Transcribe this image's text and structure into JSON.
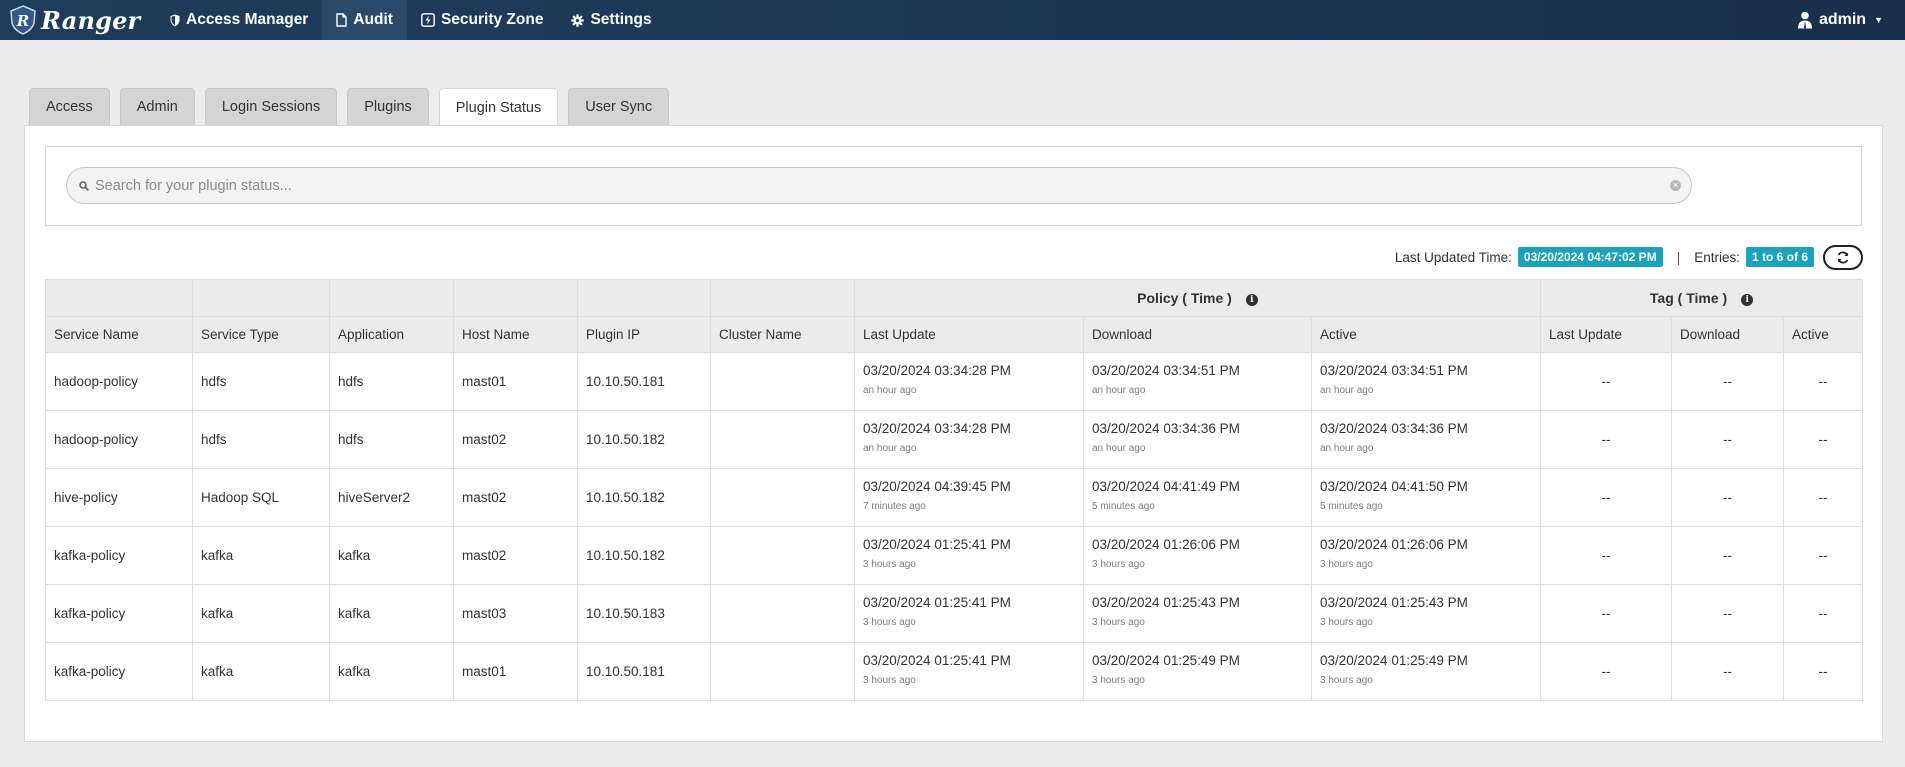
{
  "navbar": {
    "brand": "Ranger",
    "items": [
      {
        "label": "Access Manager",
        "icon": "shield-icon"
      },
      {
        "label": "Audit",
        "icon": "file-icon"
      },
      {
        "label": "Security Zone",
        "icon": "bolt-box-icon"
      },
      {
        "label": "Settings",
        "icon": "gear-icon"
      }
    ],
    "active_item": "Audit",
    "user": "admin"
  },
  "tabs": [
    {
      "label": "Access"
    },
    {
      "label": "Admin"
    },
    {
      "label": "Login Sessions"
    },
    {
      "label": "Plugins"
    },
    {
      "label": "Plugin Status"
    },
    {
      "label": "User Sync"
    }
  ],
  "active_tab": "Plugin Status",
  "search": {
    "placeholder": "Search for your plugin status...",
    "value": ""
  },
  "info": {
    "last_updated_label": "Last Updated Time:",
    "last_updated_value": "03/20/2024 04:47:02 PM",
    "separator": "|",
    "entries_label": "Entries:",
    "entries_value": "1 to 6 of 6"
  },
  "table": {
    "group_headers": {
      "policy": "Policy ( Time )",
      "tag": "Tag ( Time )"
    },
    "columns": [
      "Service Name",
      "Service Type",
      "Application",
      "Host Name",
      "Plugin IP",
      "Cluster Name",
      "Last Update",
      "Download",
      "Active",
      "Last Update",
      "Download",
      "Active"
    ],
    "rows": [
      {
        "service_name": "hadoop-policy",
        "service_type": "hdfs",
        "application": "hdfs",
        "host_name": "mast01",
        "plugin_ip": "10.10.50.181",
        "cluster_name": "",
        "policy_last_update": "03/20/2024 03:34:28 PM",
        "policy_last_update_ago": "an hour ago",
        "policy_download": "03/20/2024 03:34:51 PM",
        "policy_download_ago": "an hour ago",
        "policy_active": "03/20/2024 03:34:51 PM",
        "policy_active_ago": "an hour ago",
        "tag_last_update": "--",
        "tag_download": "--",
        "tag_active": "--"
      },
      {
        "service_name": "hadoop-policy",
        "service_type": "hdfs",
        "application": "hdfs",
        "host_name": "mast02",
        "plugin_ip": "10.10.50.182",
        "cluster_name": "",
        "policy_last_update": "03/20/2024 03:34:28 PM",
        "policy_last_update_ago": "an hour ago",
        "policy_download": "03/20/2024 03:34:36 PM",
        "policy_download_ago": "an hour ago",
        "policy_active": "03/20/2024 03:34:36 PM",
        "policy_active_ago": "an hour ago",
        "tag_last_update": "--",
        "tag_download": "--",
        "tag_active": "--"
      },
      {
        "service_name": "hive-policy",
        "service_type": "Hadoop SQL",
        "application": "hiveServer2",
        "host_name": "mast02",
        "plugin_ip": "10.10.50.182",
        "cluster_name": "",
        "policy_last_update": "03/20/2024 04:39:45 PM",
        "policy_last_update_ago": "7 minutes ago",
        "policy_download": "03/20/2024 04:41:49 PM",
        "policy_download_ago": "5 minutes ago",
        "policy_active": "03/20/2024 04:41:50 PM",
        "policy_active_ago": "5 minutes ago",
        "tag_last_update": "--",
        "tag_download": "--",
        "tag_active": "--"
      },
      {
        "service_name": "kafka-policy",
        "service_type": "kafka",
        "application": "kafka",
        "host_name": "mast02",
        "plugin_ip": "10.10.50.182",
        "cluster_name": "",
        "policy_last_update": "03/20/2024 01:25:41 PM",
        "policy_last_update_ago": "3 hours ago",
        "policy_download": "03/20/2024 01:26:06 PM",
        "policy_download_ago": "3 hours ago",
        "policy_active": "03/20/2024 01:26:06 PM",
        "policy_active_ago": "3 hours ago",
        "tag_last_update": "--",
        "tag_download": "--",
        "tag_active": "--"
      },
      {
        "service_name": "kafka-policy",
        "service_type": "kafka",
        "application": "kafka",
        "host_name": "mast03",
        "plugin_ip": "10.10.50.183",
        "cluster_name": "",
        "policy_last_update": "03/20/2024 01:25:41 PM",
        "policy_last_update_ago": "3 hours ago",
        "policy_download": "03/20/2024 01:25:43 PM",
        "policy_download_ago": "3 hours ago",
        "policy_active": "03/20/2024 01:25:43 PM",
        "policy_active_ago": "3 hours ago",
        "tag_last_update": "--",
        "tag_download": "--",
        "tag_active": "--"
      },
      {
        "service_name": "kafka-policy",
        "service_type": "kafka",
        "application": "kafka",
        "host_name": "mast01",
        "plugin_ip": "10.10.50.181",
        "cluster_name": "",
        "policy_last_update": "03/20/2024 01:25:41 PM",
        "policy_last_update_ago": "3 hours ago",
        "policy_download": "03/20/2024 01:25:49 PM",
        "policy_download_ago": "3 hours ago",
        "policy_active": "03/20/2024 01:25:49 PM",
        "policy_active_ago": "3 hours ago",
        "tag_last_update": "--",
        "tag_download": "--",
        "tag_active": "--"
      }
    ]
  },
  "colors": {
    "navbar": "#1f3d5b",
    "badge": "#1aa2bd",
    "page_bg": "#ececec",
    "header_bg": "#ebebeb"
  }
}
